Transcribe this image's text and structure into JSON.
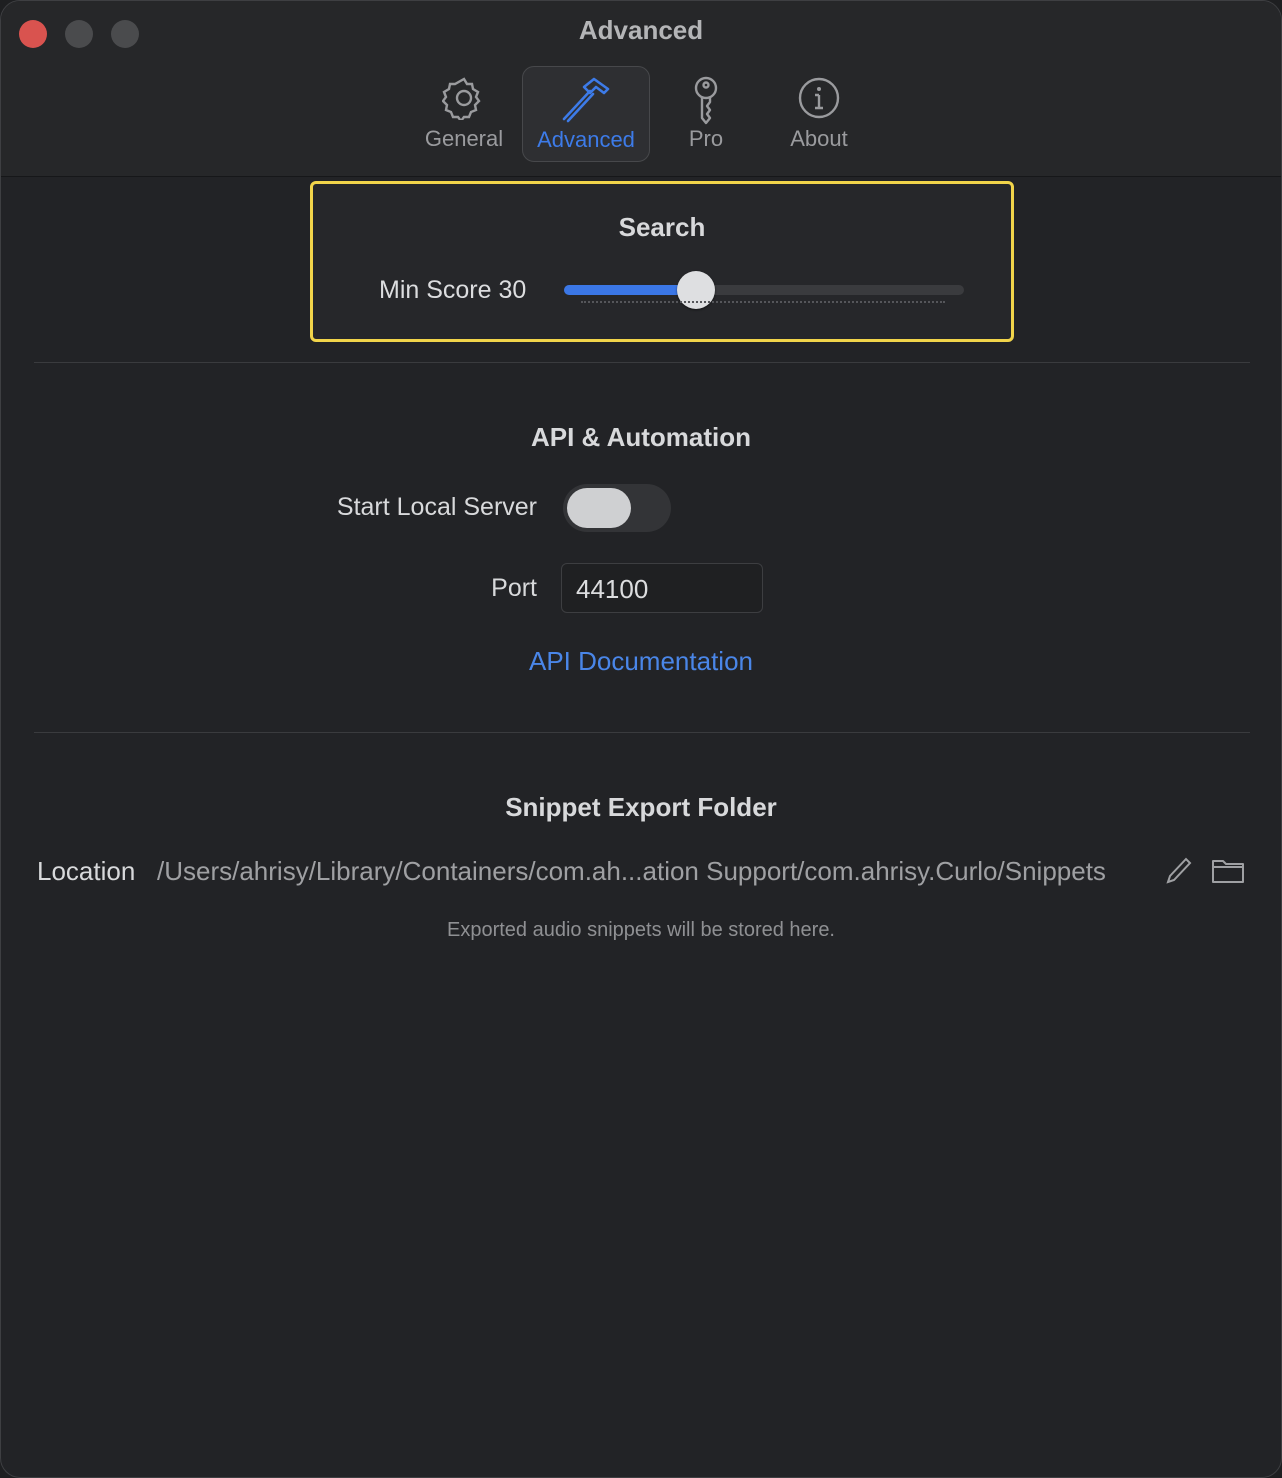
{
  "window": {
    "title": "Advanced"
  },
  "tabs": [
    {
      "label": "General",
      "icon": "gear-icon"
    },
    {
      "label": "Advanced",
      "icon": "hammer-icon",
      "active": true
    },
    {
      "label": "Pro",
      "icon": "key-icon"
    },
    {
      "label": "About",
      "icon": "info-icon"
    }
  ],
  "search": {
    "title": "Search",
    "min_score_label": "Min Score 30",
    "min_score_value": 30,
    "min_score_max": 100
  },
  "api": {
    "title": "API & Automation",
    "server_label": "Start Local Server",
    "server_enabled": false,
    "port_label": "Port",
    "port_value": "44100",
    "doc_link": "API Documentation"
  },
  "export": {
    "title": "Snippet Export Folder",
    "location_label": "Location",
    "location_path": "/Users/ahrisy/Library/Containers/com.ah...ation Support/com.ahrisy.Curlo/Snippets",
    "hint": "Exported audio snippets will be stored here."
  },
  "colors": {
    "accent": "#3b77e6",
    "highlight": "#f1d44a",
    "close": "#d9534f"
  }
}
